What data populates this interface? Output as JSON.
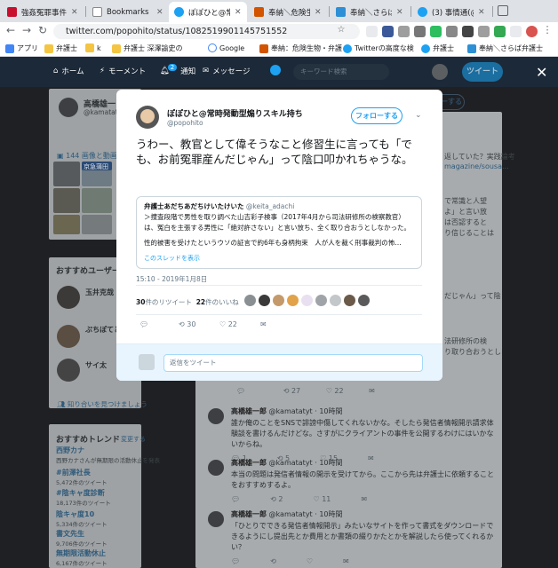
{
  "browser": {
    "tabs": [
      {
        "label": "強姦冤罪事件"
      },
      {
        "label": "Bookmarks"
      },
      {
        "label": "ぽぽひと@常時"
      },
      {
        "label": "奉納＼危険生"
      },
      {
        "label": "奉納＼さらば"
      },
      {
        "label": "(3) 事情通(@p"
      }
    ],
    "url": "twitter.com/popohito/status/1082519901145751552",
    "bookmarks": [
      {
        "label": "アプリ"
      },
      {
        "label": "弁護士"
      },
      {
        "label": "k"
      },
      {
        "label": "弁護士 深澤諭史の"
      },
      {
        "label": "Google"
      },
      {
        "label": "奉納：危険生物・弁護"
      },
      {
        "label": "Twitterの高度な検"
      },
      {
        "label": "弁護士"
      },
      {
        "label": "奉納＼さらば弁護士"
      }
    ]
  },
  "twitter_nav": {
    "home": "ホーム",
    "moments": "モーメント",
    "notifications": "通知",
    "notif_count": "2",
    "messages": "メッセージ",
    "search_placeholder": "キーワード検索",
    "tweet_button": "ツイート"
  },
  "background": {
    "profile_name": "高橋雄一",
    "profile_handle": "@kamatatyt",
    "follow_button": "フォローする",
    "media_link": "144 画像と動画",
    "photo_label": "京急蒲田",
    "recommend_title": "おすすめユーザー",
    "rec_users": [
      {
        "name": "玉井克哉"
      },
      {
        "name": "ぷちぽてと"
      },
      {
        "name": "サイ太"
      }
    ],
    "find_friends": "知り合いを見つけましょう",
    "trends_title": "おすすめトレンド",
    "trends_change": "変更する",
    "trends": [
      {
        "name": "西野カナ",
        "desc": "西野カナさんが無期限の活動休止を発表"
      },
      {
        "name": "#前澤社長",
        "desc": "5,472件のツイート"
      },
      {
        "name": "#陰キャ度診断",
        "desc": "18,173件のツイート"
      },
      {
        "name": "陰キャ度10",
        "desc": "5,334件のツイート"
      },
      {
        "name": "書文先生",
        "desc": "9,706件のツイート"
      },
      {
        "name": "無期限活動休止",
        "desc": "6,167件のツイート"
      }
    ],
    "right_snippets": [
      "返していた？実践論考",
      "magazine/sousa...",
      "で常識と人望",
      "よ」と言い放",
      "は否認すると",
      "り信じることは",
      "だじゃん」って陰",
      "法研修所の検",
      "り取り合おうとし"
    ],
    "tl_actions_top": {
      "replies": "",
      "retweets": "27",
      "likes": "22"
    },
    "timeline": [
      {
        "name": "高橋雄一郎",
        "handle": "@kamatatyt",
        "time": "10時間",
        "text": "誰か俺のことをSNSで誹謗中傷してくれないかな。そしたら発信者情報開示請求体験談を書けるんだけどな。さすがにクライアントの事件を公開するわけにはいかないからね。",
        "replies": "1",
        "retweets": "5",
        "likes": "15"
      },
      {
        "name": "高橋雄一郎",
        "handle": "@kamatatyt",
        "time": "10時間",
        "text": "本当の問題は発信者情報の開示を受けてから。ここから先は弁護士に依頼することをおすすめするよ。",
        "replies": "",
        "retweets": "2",
        "likes": "11"
      },
      {
        "name": "高橋雄一郎",
        "handle": "@kamatatyt",
        "time": "10時間",
        "text": "「ひとりでできる発信者情報開示」みたいなサイトを作って書式をダウンロードできるようにし提出先とか費用とか書類の綴りかたとかを解説したら使ってくれるかい？",
        "replies": "",
        "retweets": "",
        "likes": ""
      }
    ]
  },
  "modal": {
    "name": "ぽぽひと@常時発動型煽りスキル持ち",
    "handle": "@popohito",
    "follow_button": "フォローする",
    "text": "うわー、教官として偉そうなこと修習生に言っても「でも、お前冤罪産んだじゃん」って陰口叩かれちゃうな。",
    "quote": {
      "name": "弁護士あだちあだちけいたけいた",
      "handle": "@keita_adachi",
      "line1": "＞捜査段階で男性を取り調べた山吉彩子検事（2017年4月から司法研修所の検察教官）",
      "line2": "は、冤白を主張する男性に「絶対許さない」と言い放ち、全く取り合おうとしなかった。",
      "line3": "性的被害を受けたというウソの証言で約6年も身柄拘束　人が人を裁く刑事裁判の怖…",
      "show_thread": "このスレッドを表示"
    },
    "timestamp": "15:10 - 2019年1月8日",
    "retweet_count": "30",
    "retweet_label": "件のリツイート",
    "like_count": "22",
    "like_label": "件のいいね",
    "action_retweets": "30",
    "action_likes": "22",
    "reply_placeholder": "返信をツイート"
  },
  "colors": {
    "accent": "#1da1f2",
    "twitter_nav": "#1c2938",
    "overlay": "#1e2024"
  }
}
